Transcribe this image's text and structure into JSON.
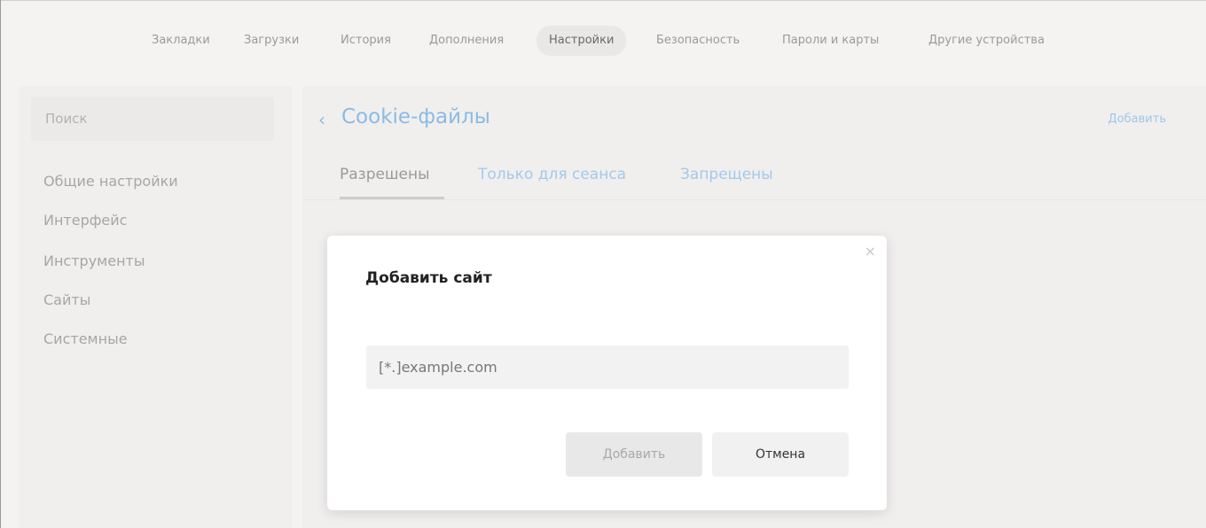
{
  "topnav": {
    "items": [
      "Закладки",
      "Загрузки",
      "История",
      "Дополнения",
      "Настройки",
      "Безопасность",
      "Пароли и карты",
      "Другие устройства"
    ],
    "active": "Настройки"
  },
  "sidebar": {
    "search_placeholder": "Поиск",
    "items": [
      "Общие настройки",
      "Интерфейс",
      "Инструменты",
      "Сайты",
      "Системные"
    ]
  },
  "main": {
    "back_arrow": "‹",
    "title": "Cookie-файлы",
    "add_link": "Добавить",
    "tabs": [
      {
        "label": "Разрешены",
        "active": true
      },
      {
        "label": "Только для сеанса",
        "active": false
      },
      {
        "label": "Запрещены",
        "active": false
      }
    ]
  },
  "dialog": {
    "close_icon": "×",
    "title": "Добавить сайт",
    "input_placeholder": "[*.]example.com",
    "add_button": "Добавить",
    "cancel_button": "Отмена"
  },
  "colors": {
    "accent": "#8bbbe4",
    "background": "#f4f3f2",
    "dialog_bg": "#ffffff"
  }
}
